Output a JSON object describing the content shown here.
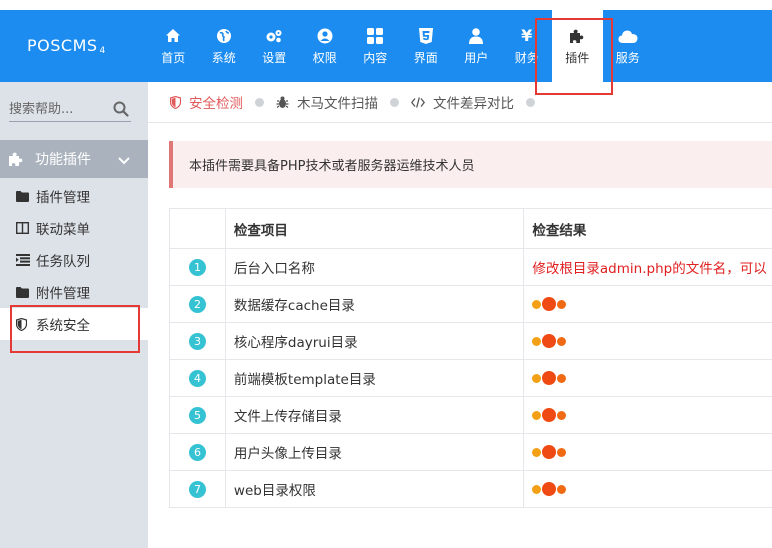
{
  "app": {
    "logo": "POSCMS",
    "logo_version": "4"
  },
  "topnav": [
    {
      "label": "首页",
      "icon": "home-icon"
    },
    {
      "label": "系统",
      "icon": "globe-icon"
    },
    {
      "label": "设置",
      "icon": "cogs-icon"
    },
    {
      "label": "权限",
      "icon": "user-circle-icon"
    },
    {
      "label": "内容",
      "icon": "grid-icon"
    },
    {
      "label": "界面",
      "icon": "html5-icon"
    },
    {
      "label": "用户",
      "icon": "user-icon"
    },
    {
      "label": "财务",
      "icon": "yen-icon"
    },
    {
      "label": "插件",
      "icon": "puzzle-icon"
    },
    {
      "label": "服务",
      "icon": "cloud-icon"
    }
  ],
  "active_nav": "插件",
  "search": {
    "placeholder": "搜索帮助..."
  },
  "sidebar": {
    "group": "功能插件",
    "items": [
      {
        "label": "插件管理",
        "icon": "folder-icon"
      },
      {
        "label": "联动菜单",
        "icon": "columns-icon"
      },
      {
        "label": "任务队列",
        "icon": "list-icon"
      },
      {
        "label": "附件管理",
        "icon": "folder-icon"
      },
      {
        "label": "系统安全",
        "icon": "shield-icon"
      }
    ],
    "active": "系统安全"
  },
  "tabs": [
    {
      "label": "安全检测",
      "icon": "shield-icon"
    },
    {
      "label": "木马文件扫描",
      "icon": "bug-icon"
    },
    {
      "label": "文件差异对比",
      "icon": "code-icon"
    }
  ],
  "alert": "本插件需要具备PHP技术或者服务器运维技术人员",
  "table": {
    "headers": [
      "检查项目",
      "检查结果"
    ],
    "rows": [
      {
        "num": "1",
        "item": "后台入口名称",
        "result": "修改根目录admin.php的文件名，可以"
      },
      {
        "num": "2",
        "item": "数据缓存cache目录",
        "result": ""
      },
      {
        "num": "3",
        "item": "核心程序dayrui目录",
        "result": ""
      },
      {
        "num": "4",
        "item": "前端模板template目录",
        "result": ""
      },
      {
        "num": "5",
        "item": "文件上传存储目录",
        "result": ""
      },
      {
        "num": "6",
        "item": "用户头像上传目录",
        "result": ""
      },
      {
        "num": "7",
        "item": "web目录权限",
        "result": ""
      }
    ]
  },
  "colors": {
    "topbar": "#1c8cf0",
    "accent": "#35c3d4",
    "error": "#e02020",
    "highlight": "#e53935"
  }
}
